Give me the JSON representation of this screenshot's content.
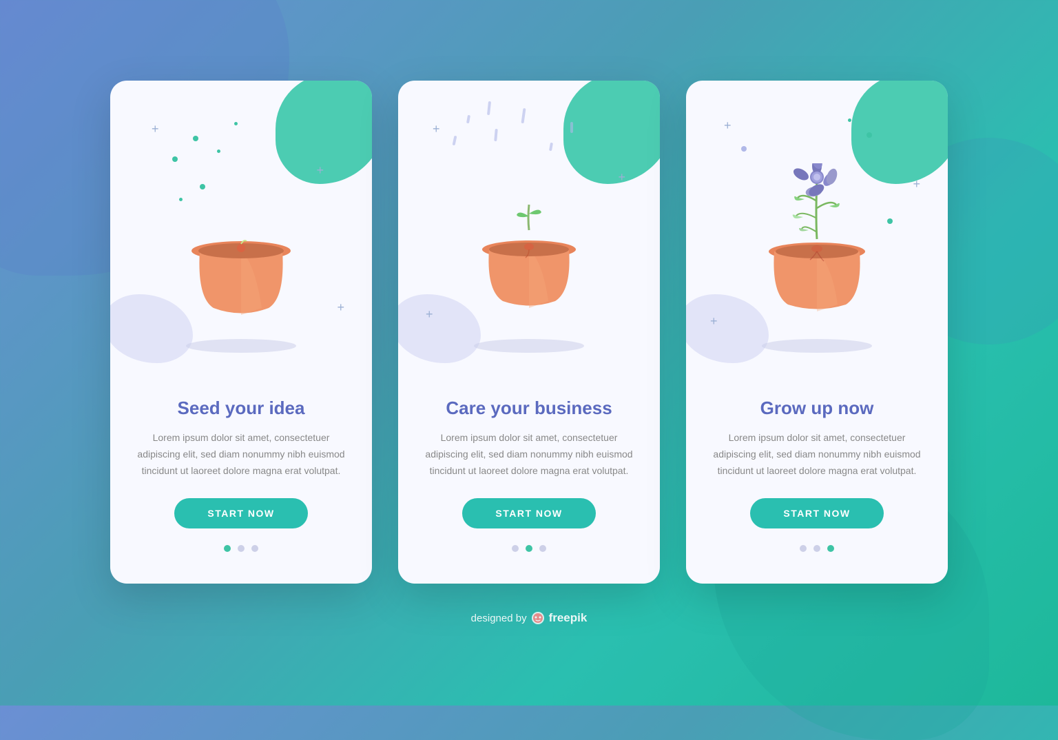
{
  "background": {
    "gradient_start": "#6b8fd4",
    "gradient_end": "#1db89a"
  },
  "cards": [
    {
      "id": "card-1",
      "title": "Seed your idea",
      "description": "Lorem ipsum dolor sit amet, consectetuer adipiscing elit, sed diam nonummy nibh euismod tincidunt ut laoreet dolore magna erat volutpat.",
      "button_label": "START NOW",
      "pagination": [
        "active",
        "inactive",
        "inactive"
      ],
      "plant_stage": "pot"
    },
    {
      "id": "card-2",
      "title": "Care your business",
      "description": "Lorem ipsum dolor sit amet, consectetuer adipiscing elit, sed diam nonummy nibh euismod tincidunt ut laoreet dolore magna erat volutpat.",
      "button_label": "START NOW",
      "pagination": [
        "inactive",
        "active",
        "inactive"
      ],
      "plant_stage": "sprout"
    },
    {
      "id": "card-3",
      "title": "Grow up now",
      "description": "Lorem ipsum dolor sit amet, consectetuer adipiscing elit, sed diam nonummy nibh euismod tincidunt ut laoreet dolore magna erat volutpat.",
      "button_label": "START NOW",
      "pagination": [
        "inactive",
        "inactive",
        "active"
      ],
      "plant_stage": "flower"
    }
  ],
  "footer": {
    "text": "designed by",
    "brand": "freepik"
  }
}
